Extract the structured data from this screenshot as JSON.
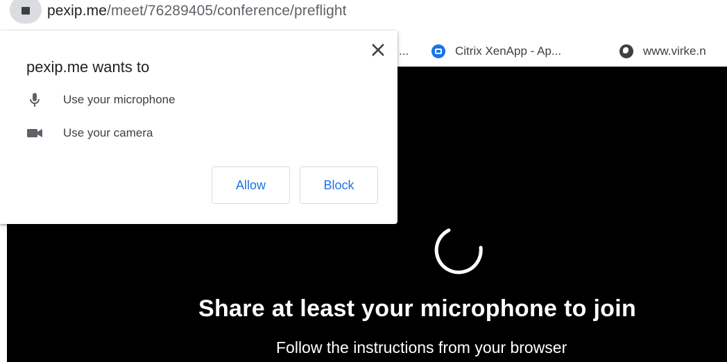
{
  "browser": {
    "url_host": "pexip.me",
    "url_path": "/meet/76289405/conference/preflight"
  },
  "bookmarks": {
    "truncated_item": "...",
    "items": [
      {
        "label": "Citrix XenApp - Ap...",
        "icon": "citrix-icon"
      },
      {
        "label": "www.virke.n",
        "icon": "globe-icon"
      }
    ]
  },
  "popup": {
    "title": "pexip.me wants to",
    "permissions": [
      {
        "label": "Use your microphone",
        "icon": "microphone-icon"
      },
      {
        "label": "Use your camera",
        "icon": "camera-icon"
      }
    ],
    "allow_label": "Allow",
    "block_label": "Block"
  },
  "stage": {
    "title": "Share at least your microphone to join",
    "subtitle": "Follow the instructions from your browser"
  },
  "colors": {
    "accent": "#1a73e8",
    "stage_background": "#000000",
    "text_primary": "#202124"
  }
}
